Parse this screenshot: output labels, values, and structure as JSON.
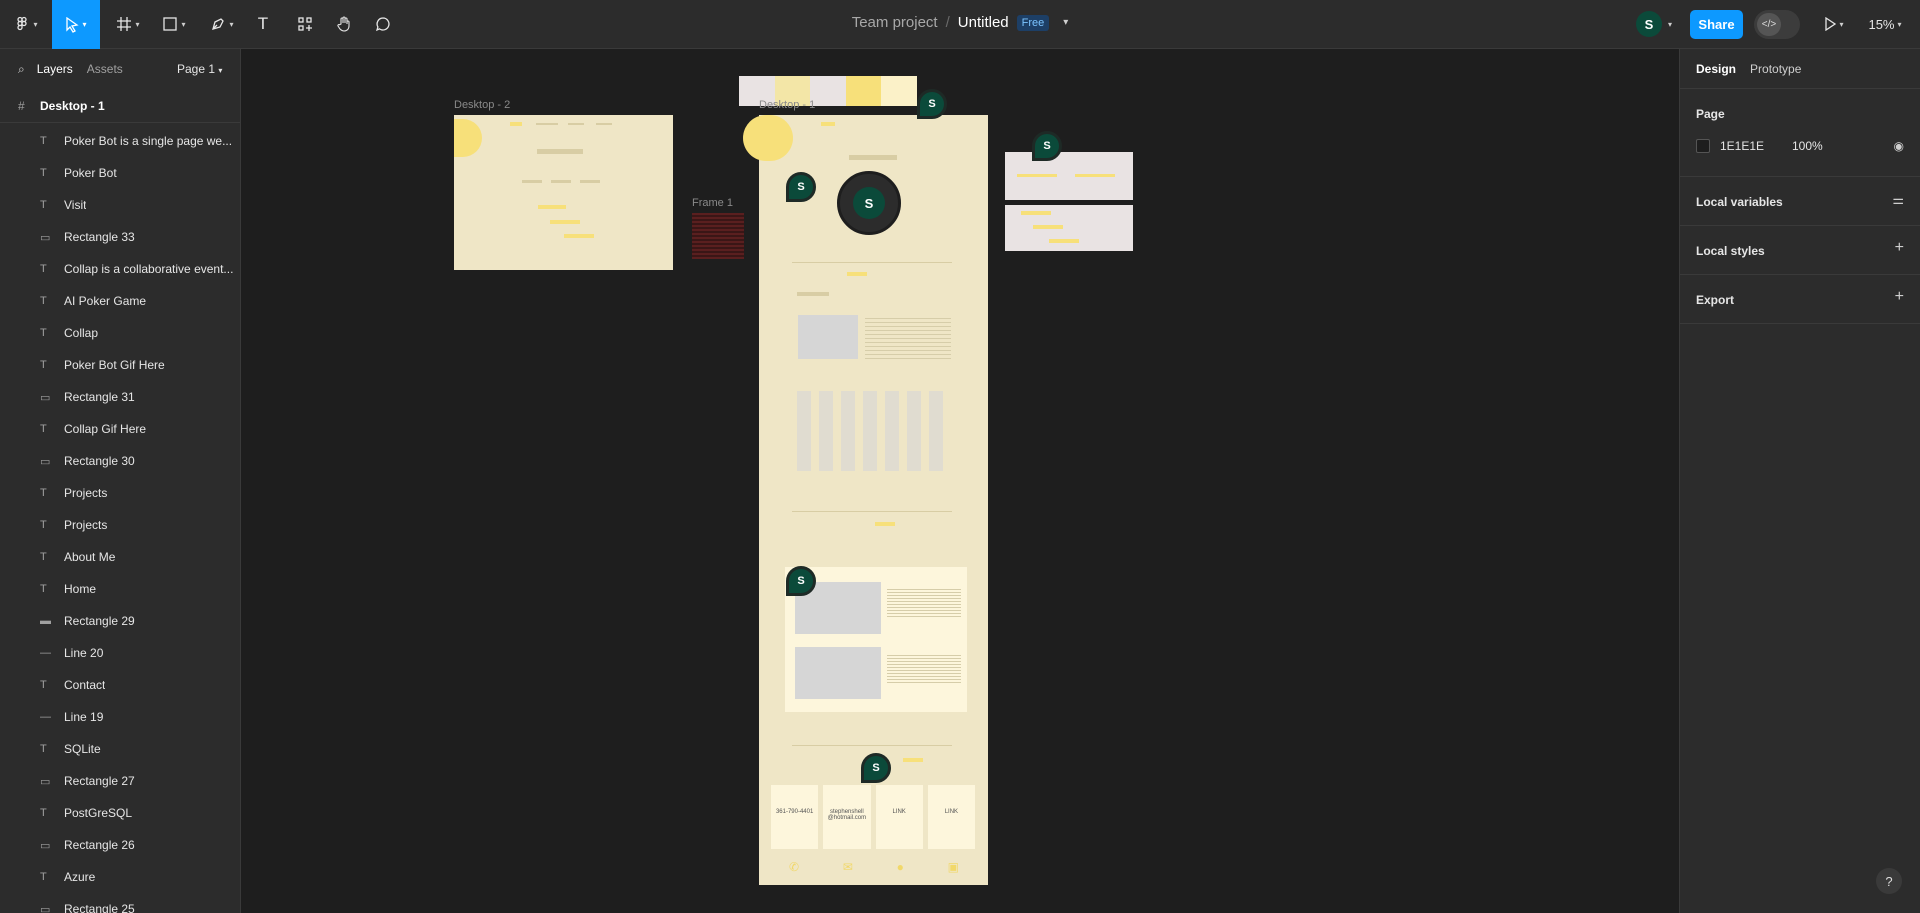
{
  "toolbar": {
    "project": "Team project",
    "separator": "/",
    "doc_name": "Untitled",
    "plan_badge": "Free",
    "user_initial": "S",
    "share_label": "Share",
    "zoom": "15%"
  },
  "left_panel": {
    "tabs": [
      "Layers",
      "Assets"
    ],
    "page_select": "Page 1",
    "top_frame": "Desktop - 1",
    "layers": [
      {
        "icon": "text-icon",
        "name": "Poker Bot is a single page we..."
      },
      {
        "icon": "text-icon",
        "name": "Poker Bot"
      },
      {
        "icon": "text-icon",
        "name": "Visit"
      },
      {
        "icon": "rectangle-icon",
        "name": "Rectangle 33"
      },
      {
        "icon": "text-icon",
        "name": "Collap is a collaborative event..."
      },
      {
        "icon": "text-icon",
        "name": "AI Poker Game"
      },
      {
        "icon": "text-icon",
        "name": "Collap"
      },
      {
        "icon": "text-icon",
        "name": "Poker Bot Gif Here"
      },
      {
        "icon": "rectangle-icon",
        "name": "Rectangle 31"
      },
      {
        "icon": "text-icon",
        "name": "Collap Gif Here"
      },
      {
        "icon": "rectangle-icon",
        "name": "Rectangle 30"
      },
      {
        "icon": "text-icon",
        "name": "Projects"
      },
      {
        "icon": "text-icon",
        "name": "Projects"
      },
      {
        "icon": "text-icon",
        "name": "About Me"
      },
      {
        "icon": "text-icon",
        "name": "Home"
      },
      {
        "icon": "line-rect-icon",
        "name": "Rectangle 29"
      },
      {
        "icon": "line-icon",
        "name": "Line 20"
      },
      {
        "icon": "text-icon",
        "name": "Contact"
      },
      {
        "icon": "line-icon",
        "name": "Line 19"
      },
      {
        "icon": "text-icon",
        "name": "SQLite"
      },
      {
        "icon": "rectangle-icon",
        "name": "Rectangle 27"
      },
      {
        "icon": "text-icon",
        "name": "PostGreSQL"
      },
      {
        "icon": "rectangle-icon",
        "name": "Rectangle 26"
      },
      {
        "icon": "text-icon",
        "name": "Azure"
      },
      {
        "icon": "rectangle-icon",
        "name": "Rectangle 25"
      }
    ]
  },
  "right_panel": {
    "tabs": [
      "Design",
      "Prototype"
    ],
    "page_heading": "Page",
    "page_color": "1E1E1E",
    "page_opacity": "100%",
    "sections": [
      "Local variables",
      "Local styles",
      "Export"
    ]
  },
  "canvas": {
    "frames": {
      "desktop2": "Desktop - 2",
      "frame1": "Frame 1",
      "desktop1": "Desktop - 1"
    },
    "contact_cards": [
      "361-790-4401",
      "stephenshell @hotmail.com",
      "LINK",
      "LINK"
    ]
  }
}
